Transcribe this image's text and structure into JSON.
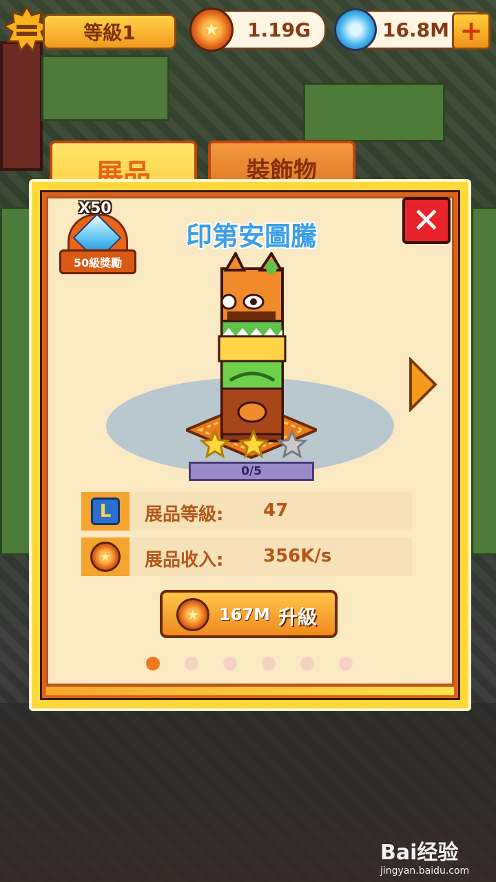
{
  "hud": {
    "level_label": "等級1",
    "coins": "1.19G",
    "gems": "16.8M",
    "add_label": "+"
  },
  "tabs": [
    {
      "label": "展品",
      "active": true
    },
    {
      "label": "裝飾物",
      "active": false
    }
  ],
  "item": {
    "title": "印第安圖騰",
    "reward_multiplier": "X50",
    "reward_label": "50級獎勵",
    "progress_text": "0/5",
    "progress_fraction": 0,
    "stars_filled": 2,
    "stars_total": 3
  },
  "stats": [
    {
      "label": "展品等級:",
      "value": "47",
      "icon": "level-icon"
    },
    {
      "label": "展品收入:",
      "value": "356K/s",
      "icon": "coin-icon"
    }
  ],
  "upgrade": {
    "cost": "167M",
    "label": "升級"
  },
  "pager": {
    "count": 6,
    "active_index": 0
  },
  "watermark": {
    "logo": "Bai经验",
    "url": "jingyan.baidu.com"
  },
  "colors": {
    "panel_border": "#ffd93a",
    "accent_orange": "#f08a1e",
    "title_blue": "#3a9ee8",
    "close_red": "#e8232b"
  }
}
